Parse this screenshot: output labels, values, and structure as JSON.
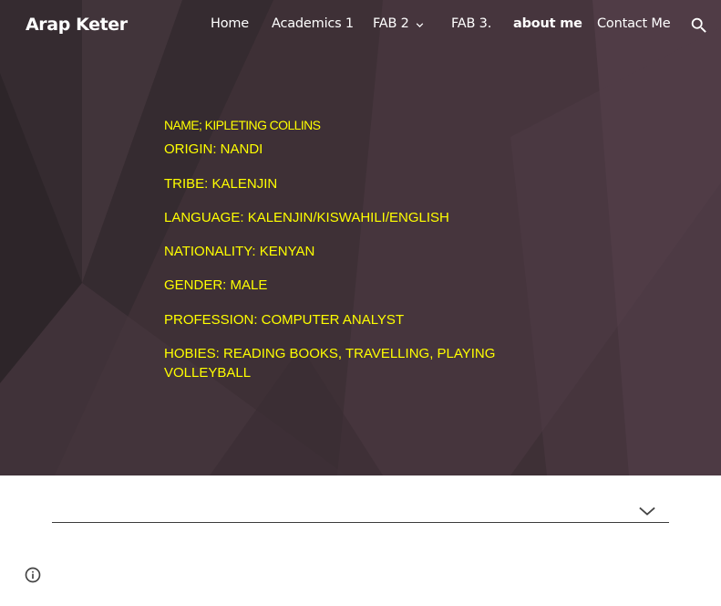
{
  "header": {
    "site_title": "Arap Keter",
    "nav": [
      {
        "label": "Home"
      },
      {
        "label": "Academics 1"
      },
      {
        "label": "FAB 2"
      },
      {
        "label": "FAB 3."
      },
      {
        "label": "about me"
      },
      {
        "label": "Contact Me"
      }
    ],
    "active_item": "about me",
    "icons": {
      "dropdown": "chevron-down-icon",
      "search": "search-icon"
    }
  },
  "profile": {
    "name": "NAME; KIPLETING COLLINS",
    "origin": "ORIGIN: NANDI",
    "tribe": "TRIBE: KALENJIN",
    "language": "LANGUAGE: KALENJIN/KISWAHILI/ENGLISH",
    "nationality": "NATIONALITY: KENYAN",
    "gender": "GENDER: MALE",
    "profession": "PROFESSION: COMPUTER ANALYST",
    "hobbies": "HOBIES: READING BOOKS, TRAVELLING, PLAYING VOLLEYBALL"
  },
  "footer": {
    "icons": {
      "expand": "chevron-down-icon",
      "info": "info-icon"
    }
  },
  "colors": {
    "hero_background": "#3d2f35",
    "text_accent": "#ffff00",
    "nav_text": "#ffffff"
  }
}
